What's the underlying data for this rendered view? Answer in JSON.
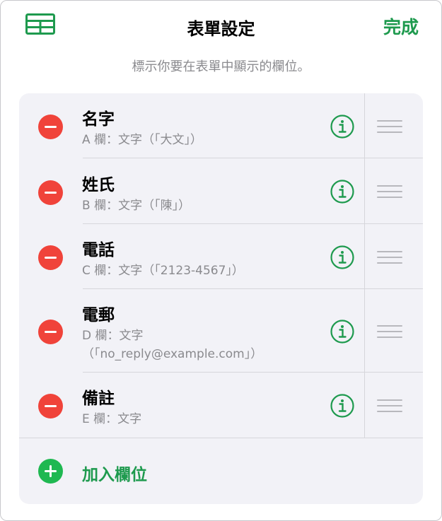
{
  "header": {
    "title": "表單設定",
    "done_label": "完成",
    "subtitle": "標示你要在表單中顯示的欄位。"
  },
  "fields": [
    {
      "title": "名字",
      "subtitle": "A 欄：文字（「大文」）"
    },
    {
      "title": "姓氏",
      "subtitle": "B 欄：文字（「陳」）"
    },
    {
      "title": "電話",
      "subtitle": "C 欄：文字（「2123-4567」）"
    },
    {
      "title": "電郵",
      "subtitle": "D 欄：文字\n（「no_reply@example.com」）"
    },
    {
      "title": "備註",
      "subtitle": "E 欄：文字"
    }
  ],
  "add_field_label": "加入欄位",
  "colors": {
    "accent_green": "#1e9a4e",
    "remove_red": "#f0433a",
    "add_green": "#1fb851"
  },
  "icons": {
    "table": "table-icon",
    "remove": "minus-circle-icon",
    "info": "info-circle-icon",
    "drag": "drag-handle-icon",
    "add": "plus-circle-icon"
  }
}
